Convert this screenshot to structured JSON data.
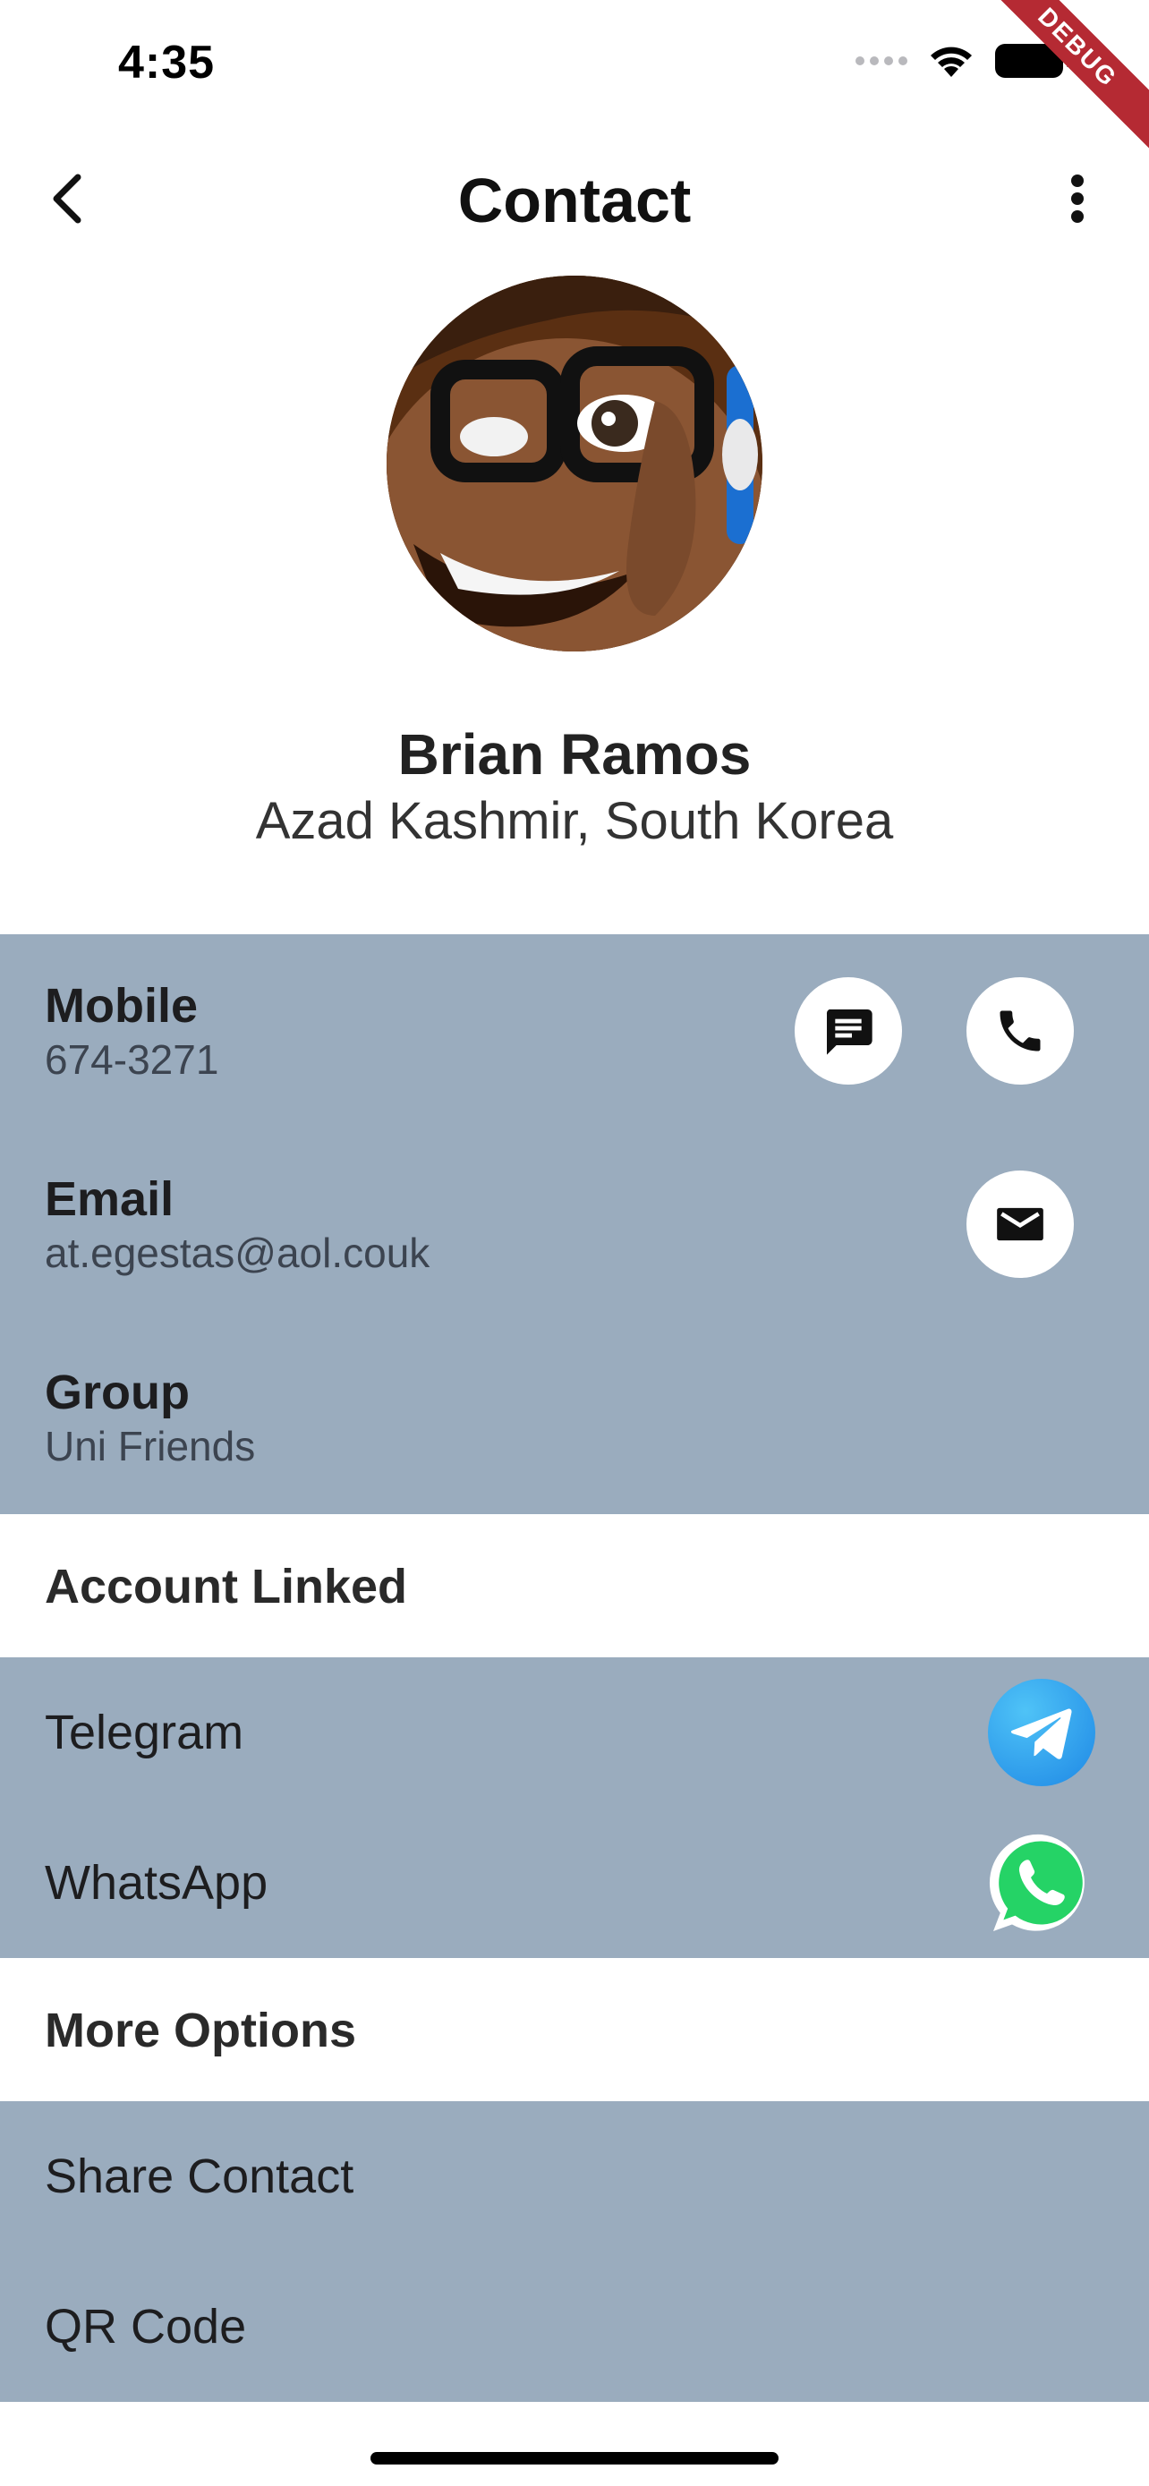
{
  "status_bar": {
    "time": "4:35"
  },
  "debug_banner": "DEBUG",
  "app_bar": {
    "title": "Contact",
    "back_icon": "chevron-left-icon",
    "menu_icon": "more-vertical-icon"
  },
  "profile": {
    "name": "Brian Ramos",
    "location": "Azad Kashmir, South Korea"
  },
  "details": {
    "mobile": {
      "label": "Mobile",
      "value": "674-3271"
    },
    "email": {
      "label": "Email",
      "value": "at.egestas@aol.couk"
    },
    "group": {
      "label": "Group",
      "value": "Uni Friends"
    }
  },
  "accounts": {
    "header": "Account Linked",
    "items": [
      {
        "label": "Telegram",
        "icon": "telegram-icon"
      },
      {
        "label": "WhatsApp",
        "icon": "whatsapp-icon"
      }
    ]
  },
  "more_options": {
    "header": "More Options",
    "items": [
      {
        "label": "Share Contact"
      },
      {
        "label": "QR Code"
      }
    ]
  },
  "colors": {
    "panel": "#9aacbe",
    "telegram": "#2aa3e6",
    "whatsapp": "#25d366"
  }
}
